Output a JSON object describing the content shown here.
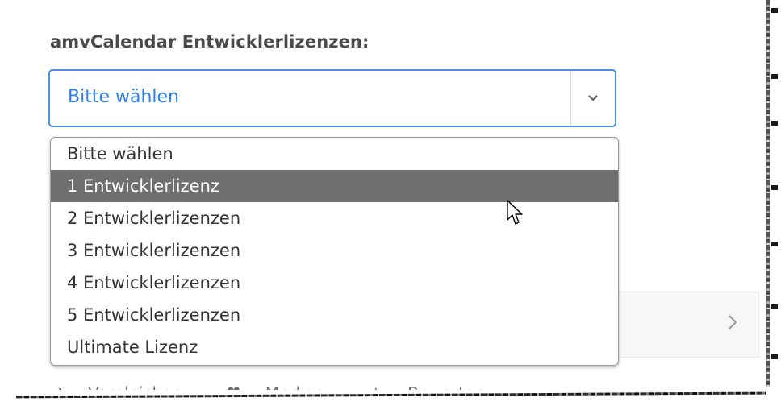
{
  "form": {
    "label": "amvCalendar Entwicklerlizenzen:",
    "select_value": "Bitte wählen",
    "options": [
      "Bitte wählen",
      "1 Entwicklerlizenz",
      "2 Entwicklerlizenzen",
      "3 Entwicklerlizenzen",
      "4 Entwicklerlizenzen",
      "5 Entwicklerlizenzen",
      "Ultimate Lizenz"
    ],
    "highlighted_option": "1 Entwicklerlizenz"
  },
  "actions": {
    "compare": "Vergleichen",
    "remember": "Merken",
    "rate": "Bewerten"
  },
  "icons": [
    "chevron-down-icon",
    "chevron-right-icon",
    "compare-icon",
    "heart-icon",
    "star-icon",
    "mouse-cursor-icon"
  ],
  "colors": {
    "accent": "#4a90e2",
    "value_text": "#2f7fe6",
    "highlight": "#6f6f6f"
  }
}
